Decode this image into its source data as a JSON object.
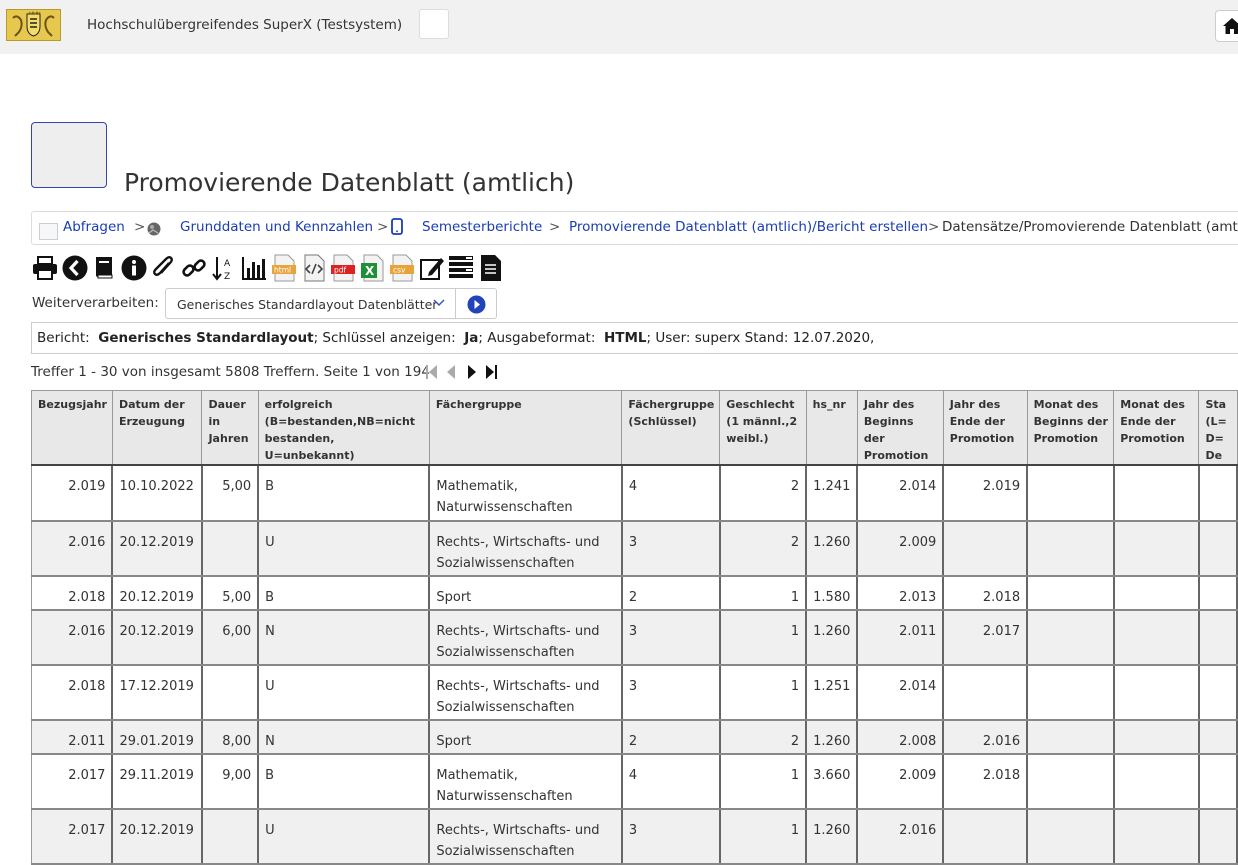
{
  "header": {
    "app_title": "Hochschulübergreifendes SuperX (Testsystem)",
    "logo_icon": "coat-of-arms",
    "home_icon": "home-icon"
  },
  "page": {
    "title": "Promovierende Datenblatt (amtlich)"
  },
  "breadcrumb": {
    "items": [
      {
        "label": "Abfragen",
        "icon": "checkbox"
      },
      {
        "label": "Grunddaten und Kennzahlen",
        "icon": "lion-icon"
      },
      {
        "label": "Semesterberichte",
        "icon": "tablet-icon"
      },
      {
        "label": "Promovierende Datenblatt (amtlich)/Bericht erstellen"
      },
      {
        "label": "Datensätze/Promovierende Datenblatt (amtlich)"
      }
    ],
    "separator": ">"
  },
  "toolbar": {
    "tools": [
      "print-icon",
      "back-icon",
      "book-icon",
      "info-icon",
      "paperclip-icon",
      "link-icon",
      "sort-az-icon",
      "chart-icon",
      "html-export-icon",
      "source-code-icon",
      "pdf-export-icon",
      "excel-export-icon",
      "csv-export-icon",
      "edit-icon",
      "table-layout-icon",
      "document-icon"
    ],
    "labels": {
      "html": "html",
      "pdf": "pdf",
      "xls": "X",
      "csv": "csv"
    }
  },
  "weiterverarbeiten": {
    "label": "Weiterverarbeiten:",
    "selected": "Generisches Standardlayout Datenblätter"
  },
  "info": {
    "bericht_label": "Bericht:",
    "bericht_value": "Generisches Standardlayout",
    "schluessel_label": "; Schlüssel anzeigen:",
    "schluessel_value": "Ja",
    "format_label": "; Ausgabeformat:",
    "format_value": "HTML",
    "rest": "; User: superx Stand: 12.07.2020,"
  },
  "result": {
    "summary": "Treffer 1 - 30 von insgesamt 5808 Treffern. Seite 1 von 194"
  },
  "table": {
    "columns": [
      "Bezugsjahr",
      "Datum der Erzeugung",
      "Dauer in Jahren",
      "erfolgreich (B=bestanden,NB=nicht bestanden, U=unbekannt)",
      "Fächergruppe",
      "Fächergruppe (Schlüssel)",
      "Geschlecht (1 männl.,2 weibl.)",
      "hs_nr",
      "Jahr des Beginns der Promotion",
      "Jahr des Ende der Promotion",
      "Monat des Beginns der Promotion",
      "Monat des Ende der Promotion",
      "Sta (L= D= De"
    ],
    "rows": [
      [
        "2.019",
        "10.10.2022",
        "5,00",
        "B",
        "Mathematik, Naturwissenschaften",
        "4",
        "2",
        "1.241",
        "2.014",
        "2.019",
        "",
        "",
        ""
      ],
      [
        "2.016",
        "20.12.2019",
        "",
        "U",
        "Rechts-, Wirtschafts- und Sozialwissenschaften",
        "3",
        "2",
        "1.260",
        "2.009",
        "",
        "",
        "",
        ""
      ],
      [
        "2.018",
        "20.12.2019",
        "5,00",
        "B",
        "Sport",
        "2",
        "1",
        "1.580",
        "2.013",
        "2.018",
        "",
        "",
        ""
      ],
      [
        "2.016",
        "20.12.2019",
        "6,00",
        "N",
        "Rechts-, Wirtschafts- und Sozialwissenschaften",
        "3",
        "1",
        "1.260",
        "2.011",
        "2.017",
        "",
        "",
        ""
      ],
      [
        "2.018",
        "17.12.2019",
        "",
        "U",
        "Rechts-, Wirtschafts- und Sozialwissenschaften",
        "3",
        "1",
        "1.251",
        "2.014",
        "",
        "",
        "",
        ""
      ],
      [
        "2.011",
        "29.01.2019",
        "8,00",
        "N",
        "Sport",
        "2",
        "2",
        "1.260",
        "2.008",
        "2.016",
        "",
        "",
        ""
      ],
      [
        "2.017",
        "29.11.2019",
        "9,00",
        "B",
        "Mathematik, Naturwissenschaften",
        "4",
        "1",
        "3.660",
        "2.009",
        "2.018",
        "",
        "",
        ""
      ],
      [
        "2.017",
        "20.12.2019",
        "",
        "U",
        "Rechts-, Wirtschafts- und Sozialwissenschaften",
        "3",
        "1",
        "1.260",
        "2.016",
        "",
        "",
        "",
        ""
      ]
    ]
  }
}
